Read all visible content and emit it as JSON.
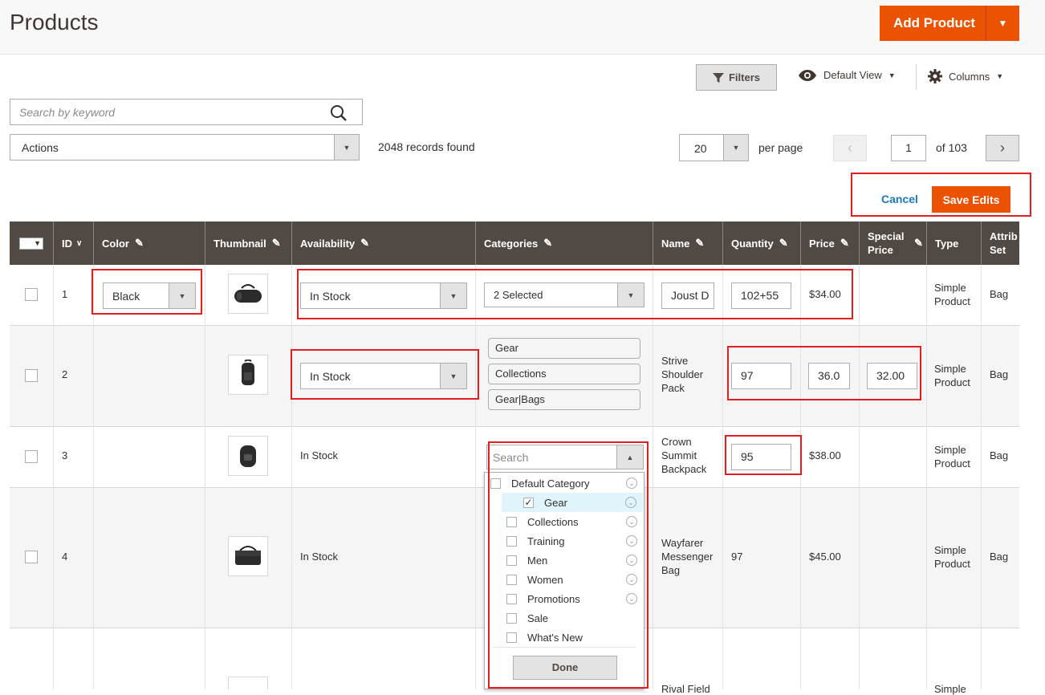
{
  "header": {
    "title": "Products",
    "add_product": "Add Product"
  },
  "toolbar": {
    "filters": "Filters",
    "default_view": "Default View",
    "columns": "Columns"
  },
  "search": {
    "placeholder": "Search by keyword"
  },
  "actions": {
    "label": "Actions",
    "records_found": "2048 records found"
  },
  "pagination": {
    "per_page_value": "20",
    "per_page_label": "per page",
    "current_page": "1",
    "of_total": "of 103"
  },
  "edit_bar": {
    "cancel": "Cancel",
    "save": "Save Edits"
  },
  "columns": [
    "ID",
    "Color",
    "Thumbnail",
    "Availability",
    "Categories",
    "Name",
    "Quantity",
    "Price",
    "Special Price",
    "Type",
    "Attrib Set"
  ],
  "rows": [
    {
      "id": "1",
      "color": "Black",
      "availability": "In Stock",
      "categories": "2 Selected",
      "name": "Joust D",
      "quantity": "102+55",
      "price": "$34.00",
      "special": "",
      "type": "Simple Product",
      "attr": "Bag"
    },
    {
      "id": "2",
      "color": "",
      "availability": "In Stock",
      "categories_tags": [
        "Gear",
        "Collections",
        "Gear|Bags"
      ],
      "name": "Strive Shoulder Pack",
      "quantity": "97",
      "price": "36.0",
      "special": "32.00",
      "type": "Simple Product",
      "attr": "Bag"
    },
    {
      "id": "3",
      "color": "",
      "availability": "In Stock",
      "category_search_placeholder": "Search",
      "name": "Crown Summit Backpack",
      "quantity": "95",
      "price": "$38.00",
      "special": "",
      "type": "Simple Product",
      "attr": "Bag"
    },
    {
      "id": "4",
      "color": "",
      "availability": "In Stock",
      "name": "Wayfarer Messenger Bag",
      "quantity": "97",
      "price": "$45.00",
      "special": "",
      "type": "Simple Product",
      "attr": "Bag"
    },
    {
      "id": "",
      "name": "Rival Field",
      "type": "Simple"
    }
  ],
  "category_dropdown": {
    "items": [
      {
        "label": "Default Category",
        "checked": false,
        "expandable": true
      },
      {
        "label": "Gear",
        "checked": true,
        "expandable": true
      },
      {
        "label": "Collections",
        "checked": false,
        "expandable": true
      },
      {
        "label": "Training",
        "checked": false,
        "expandable": true
      },
      {
        "label": "Men",
        "checked": false,
        "expandable": true
      },
      {
        "label": "Women",
        "checked": false,
        "expandable": true
      },
      {
        "label": "Promotions",
        "checked": false,
        "expandable": true
      },
      {
        "label": "Sale",
        "checked": false,
        "expandable": false
      },
      {
        "label": "What's New",
        "checked": false,
        "expandable": false
      }
    ],
    "done": "Done"
  },
  "colors": {
    "accent": "#eb5202",
    "header_bg": "#514943",
    "highlight_box": "#e41e1e",
    "link": "#1979c3"
  }
}
